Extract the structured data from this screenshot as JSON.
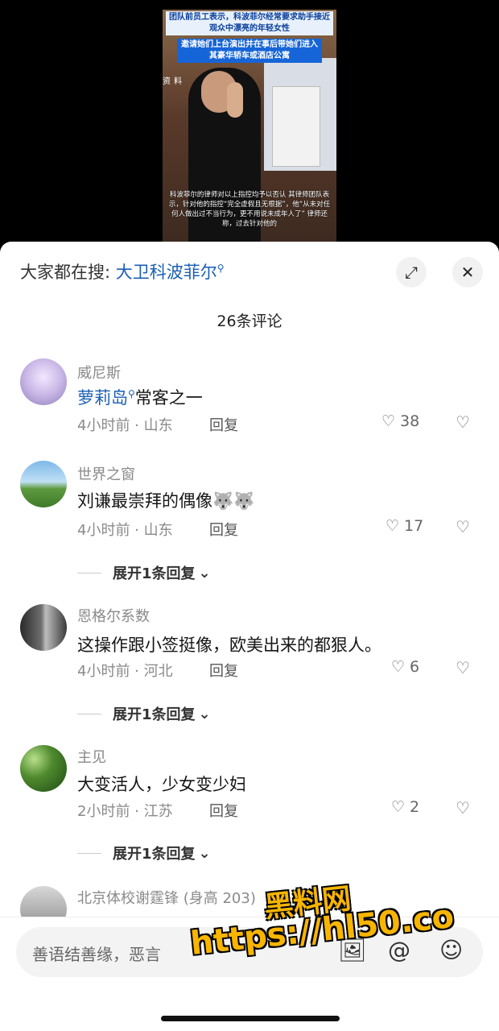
{
  "video": {
    "caption_top": "团队前员工表示，科波菲尔经常要求助手接近观众中漂亮的年轻女性",
    "caption_mid": "邀请她们上台演出并在事后带她们进入其豪华轿车或酒店公寓",
    "caption_source": "资料",
    "caption_bottom": "科波菲尔的律师对以上指控均予以否认 其律师团队表示，针对他的指控“完全虚假且无根据”，他“从未对任何人做出过不当行为，更不用说未成年人了” 律师还称，过去针对他的"
  },
  "sheet": {
    "search_prefix": "大家都在搜: ",
    "search_keyword": "大卫科波菲尔",
    "expand_icon": "expand-icon",
    "close_icon": "close-icon",
    "comment_count": "26条评论"
  },
  "comments": [
    {
      "name": "威尼斯",
      "text_keyword": "萝莉岛",
      "text": "常客之一",
      "meta": "4小时前 · 山东",
      "reply": "回复",
      "likes": "38",
      "expand": ""
    },
    {
      "name": "世界之窗",
      "text": "刘谦最崇拜的偶像🐺🐺",
      "meta": "4小时前 · 山东",
      "reply": "回复",
      "likes": "17",
      "expand": "展开1条回复"
    },
    {
      "name": "恩格尔系数",
      "text": "这操作跟小签挺像，欧美出来的都狠人。",
      "meta": "4小时前 · 河北",
      "reply": "回复",
      "likes": "6",
      "expand": "展开1条回复"
    },
    {
      "name": "主见",
      "text": "大变活人，少女变少妇",
      "meta": "2小时前 · 江苏",
      "reply": "回复",
      "likes": "2",
      "expand": "展开1条回复"
    },
    {
      "name": "北京体校谢霆锋 (身高 203)"
    }
  ],
  "input": {
    "placeholder": "善语结善缘，恶言",
    "icons": [
      "image-icon",
      "at-icon",
      "emoji-icon"
    ]
  },
  "watermark": {
    "line1": "黑料网",
    "line2": "https://hl50.co"
  }
}
